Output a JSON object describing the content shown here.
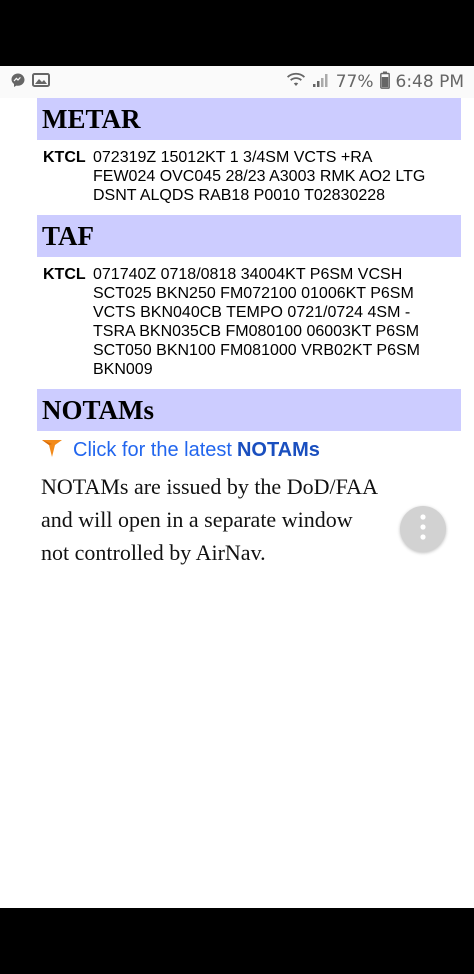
{
  "status_bar": {
    "battery_percent": "77%",
    "time": "6:48 PM",
    "icons": [
      "messenger-icon",
      "gallery-icon",
      "wifi-icon",
      "signal-icon",
      "battery-icon"
    ]
  },
  "metar": {
    "heading": "METAR",
    "station": "KTCL",
    "lines": [
      "072319Z 15012KT 1 3/4SM VCTS +RA",
      "FEW024 OVC045 28/23 A3003 RMK AO2 LTG",
      "DSNT ALQDS RAB18 P0010 T02830228"
    ]
  },
  "taf": {
    "heading": "TAF",
    "station": "KTCL",
    "lines": [
      "071740Z 0718/0818 34004KT P6SM VCSH",
      "SCT025 BKN250 FM072100 01006KT P6SM",
      "VCTS BKN040CB TEMPO 0721/0724 4SM -",
      "TSRA BKN035CB FM080100 06003KT P6SM",
      "SCT050 BKN100 FM081000 VRB02KT P6SM",
      "BKN009"
    ]
  },
  "notams": {
    "heading": "NOTAMs",
    "link_prefix": "Click for the latest",
    "link_strong": "NOTAMs",
    "description_lines": [
      "NOTAMs are issued by the DoD/FAA",
      "and will open in a separate window",
      "not controlled by AirNav."
    ]
  },
  "colors": {
    "section_header_bg": "#ccccff",
    "link": "#2266ee",
    "arrow_icon": "#f28a1a"
  }
}
